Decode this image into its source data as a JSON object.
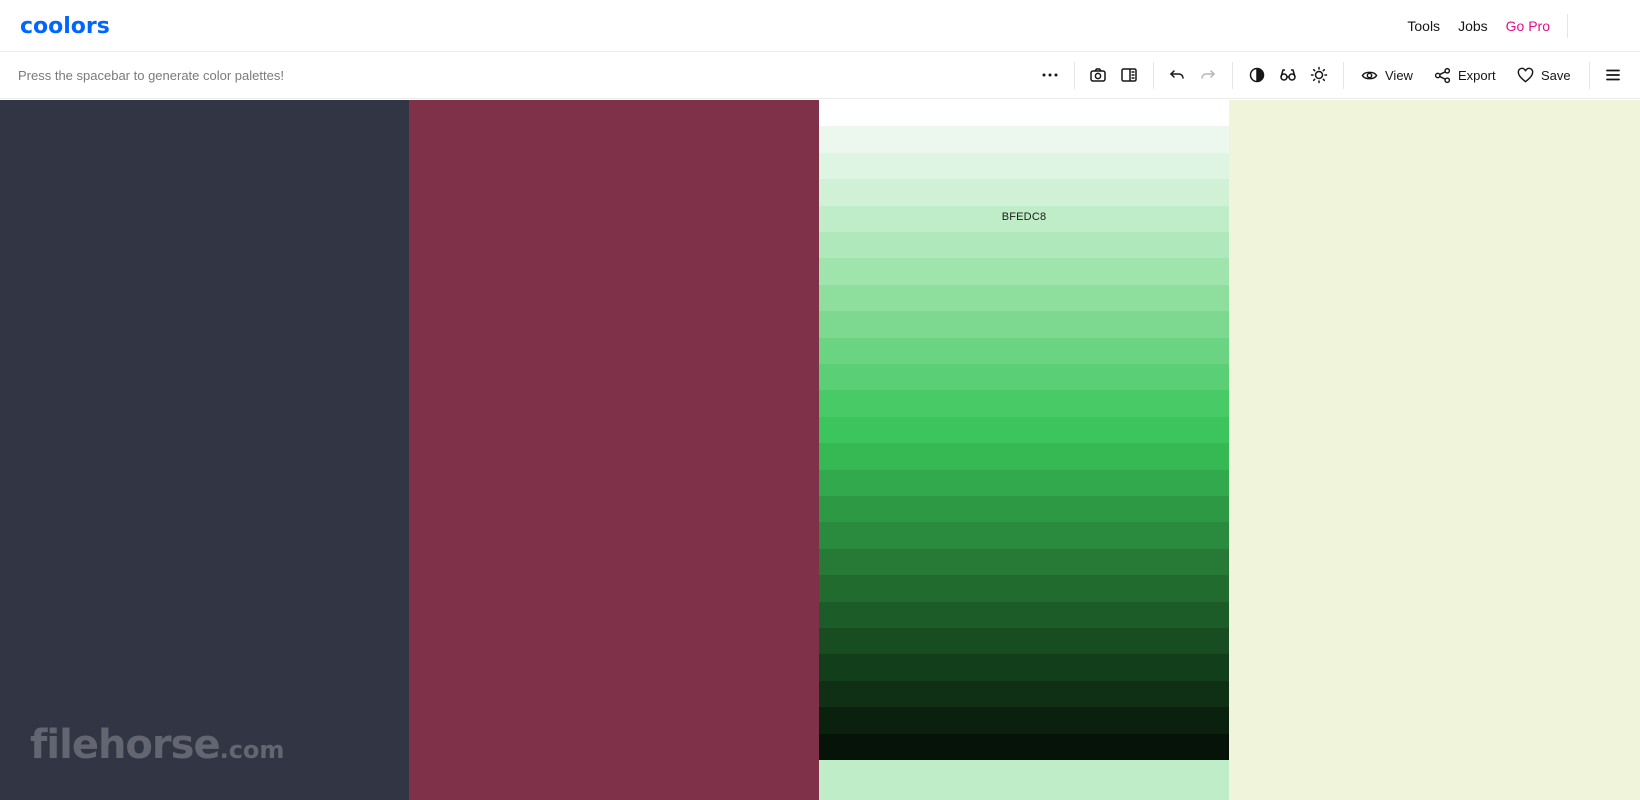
{
  "brand": {
    "logo_text": "coolors",
    "logo_color": "#0066ff"
  },
  "nav": {
    "links": [
      {
        "label": "Tools"
      },
      {
        "label": "Jobs"
      },
      {
        "label": "Go Pro",
        "color": "#e40d8e"
      }
    ]
  },
  "toolbar": {
    "hint": "Press the spacebar to generate color palettes!",
    "icons": [
      "more-horizontal-icon",
      "camera-icon",
      "panel-icon",
      "undo-icon",
      "redo-icon",
      "contrast-icon",
      "glasses-icon",
      "sun-icon",
      "eye-icon",
      "share-icon",
      "heart-icon",
      "menu-icon"
    ],
    "view_label": "View",
    "export_label": "Export",
    "save_label": "Save"
  },
  "palette": {
    "colors": [
      "#323644",
      "#7e3148",
      "#bfedc8",
      "#eff4db"
    ],
    "selected_index": 2,
    "shades": [
      "#ffffff",
      "#ecf8ee",
      "#dff5e3",
      "#d0f1d6",
      "#bfedc8",
      "#afe8ba",
      "#9fe4ac",
      "#8edf9e",
      "#7cd98f",
      "#6bd483",
      "#5acf75",
      "#48ca67",
      "#3cc55c",
      "#36b953",
      "#32a94c",
      "#2e9944",
      "#2a8a3d",
      "#267a36",
      "#216b2f",
      "#1c5c29",
      "#184d22",
      "#133e1b",
      "#0f3015",
      "#0a210e",
      "#061308"
    ],
    "selected_shade_label": "BFEDC8"
  },
  "watermark": {
    "main": "filehorse",
    "suffix": ".com"
  }
}
